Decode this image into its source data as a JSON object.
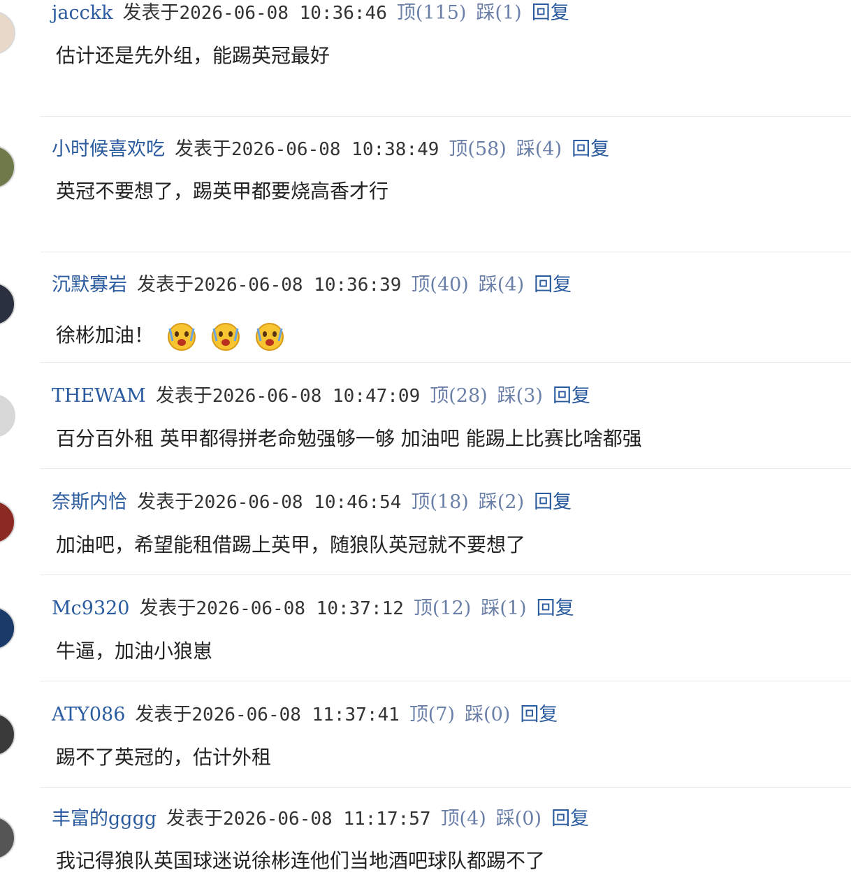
{
  "comments": [
    {
      "user": "jacckk",
      "posted_label": "发表于",
      "timestamp": "2026-06-08 10:36:46",
      "up": "顶(115)",
      "down": "踩(1)",
      "reply": "回复",
      "text": "估计还是先外组，能踢英冠最好",
      "avatar_color": "#e8d8c8"
    },
    {
      "user": "小时候喜欢吃",
      "posted_label": "发表于",
      "timestamp": "2026-06-08 10:38:49",
      "up": "顶(58)",
      "down": "踩(4)",
      "reply": "回复",
      "text": "英冠不要想了，踢英甲都要烧高香才行",
      "avatar_color": "#6f7a4a"
    },
    {
      "user": "沉默寡岩",
      "posted_label": "发表于",
      "timestamp": "2026-06-08 10:36:39",
      "up": "顶(40)",
      "down": "踩(4)",
      "reply": "回复",
      "text": "徐彬加油！",
      "avatar_color": "#2a3040"
    },
    {
      "user": "THEWAM",
      "posted_label": "发表于",
      "timestamp": "2026-06-08 10:47:09",
      "up": "顶(28)",
      "down": "踩(3)",
      "reply": "回复",
      "text": "百分百外租 英甲都得拼老命勉强够一够 加油吧 能踢上比赛比啥都强",
      "avatar_color": "#d8d8d8"
    },
    {
      "user": "奈斯内恰",
      "posted_label": "发表于",
      "timestamp": "2026-06-08 10:46:54",
      "up": "顶(18)",
      "down": "踩(2)",
      "reply": "回复",
      "text": "加油吧，希望能租借踢上英甲，随狼队英冠就不要想了",
      "avatar_color": "#8a2a22"
    },
    {
      "user": "Mc9320",
      "posted_label": "发表于",
      "timestamp": "2026-06-08 10:37:12",
      "up": "顶(12)",
      "down": "踩(1)",
      "reply": "回复",
      "text": "牛逼，加油小狼崽",
      "avatar_color": "#1a3a6a"
    },
    {
      "user": "ATY086",
      "posted_label": "发表于",
      "timestamp": "2026-06-08 11:37:41",
      "up": "顶(7)",
      "down": "踩(0)",
      "reply": "回复",
      "text": "踢不了英冠的，估计外租",
      "avatar_color": "#3a3a3a"
    },
    {
      "user": "丰富的gggg",
      "posted_label": "发表于",
      "timestamp": "2026-06-08 11:17:57",
      "up": "顶(4)",
      "down": "踩(0)",
      "reply": "回复",
      "text": "我记得狼队英国球迷说徐彬连他们当地酒吧球队都踢不了",
      "avatar_color": "#555555"
    }
  ],
  "emoji_name": "surprised-face-emoji"
}
